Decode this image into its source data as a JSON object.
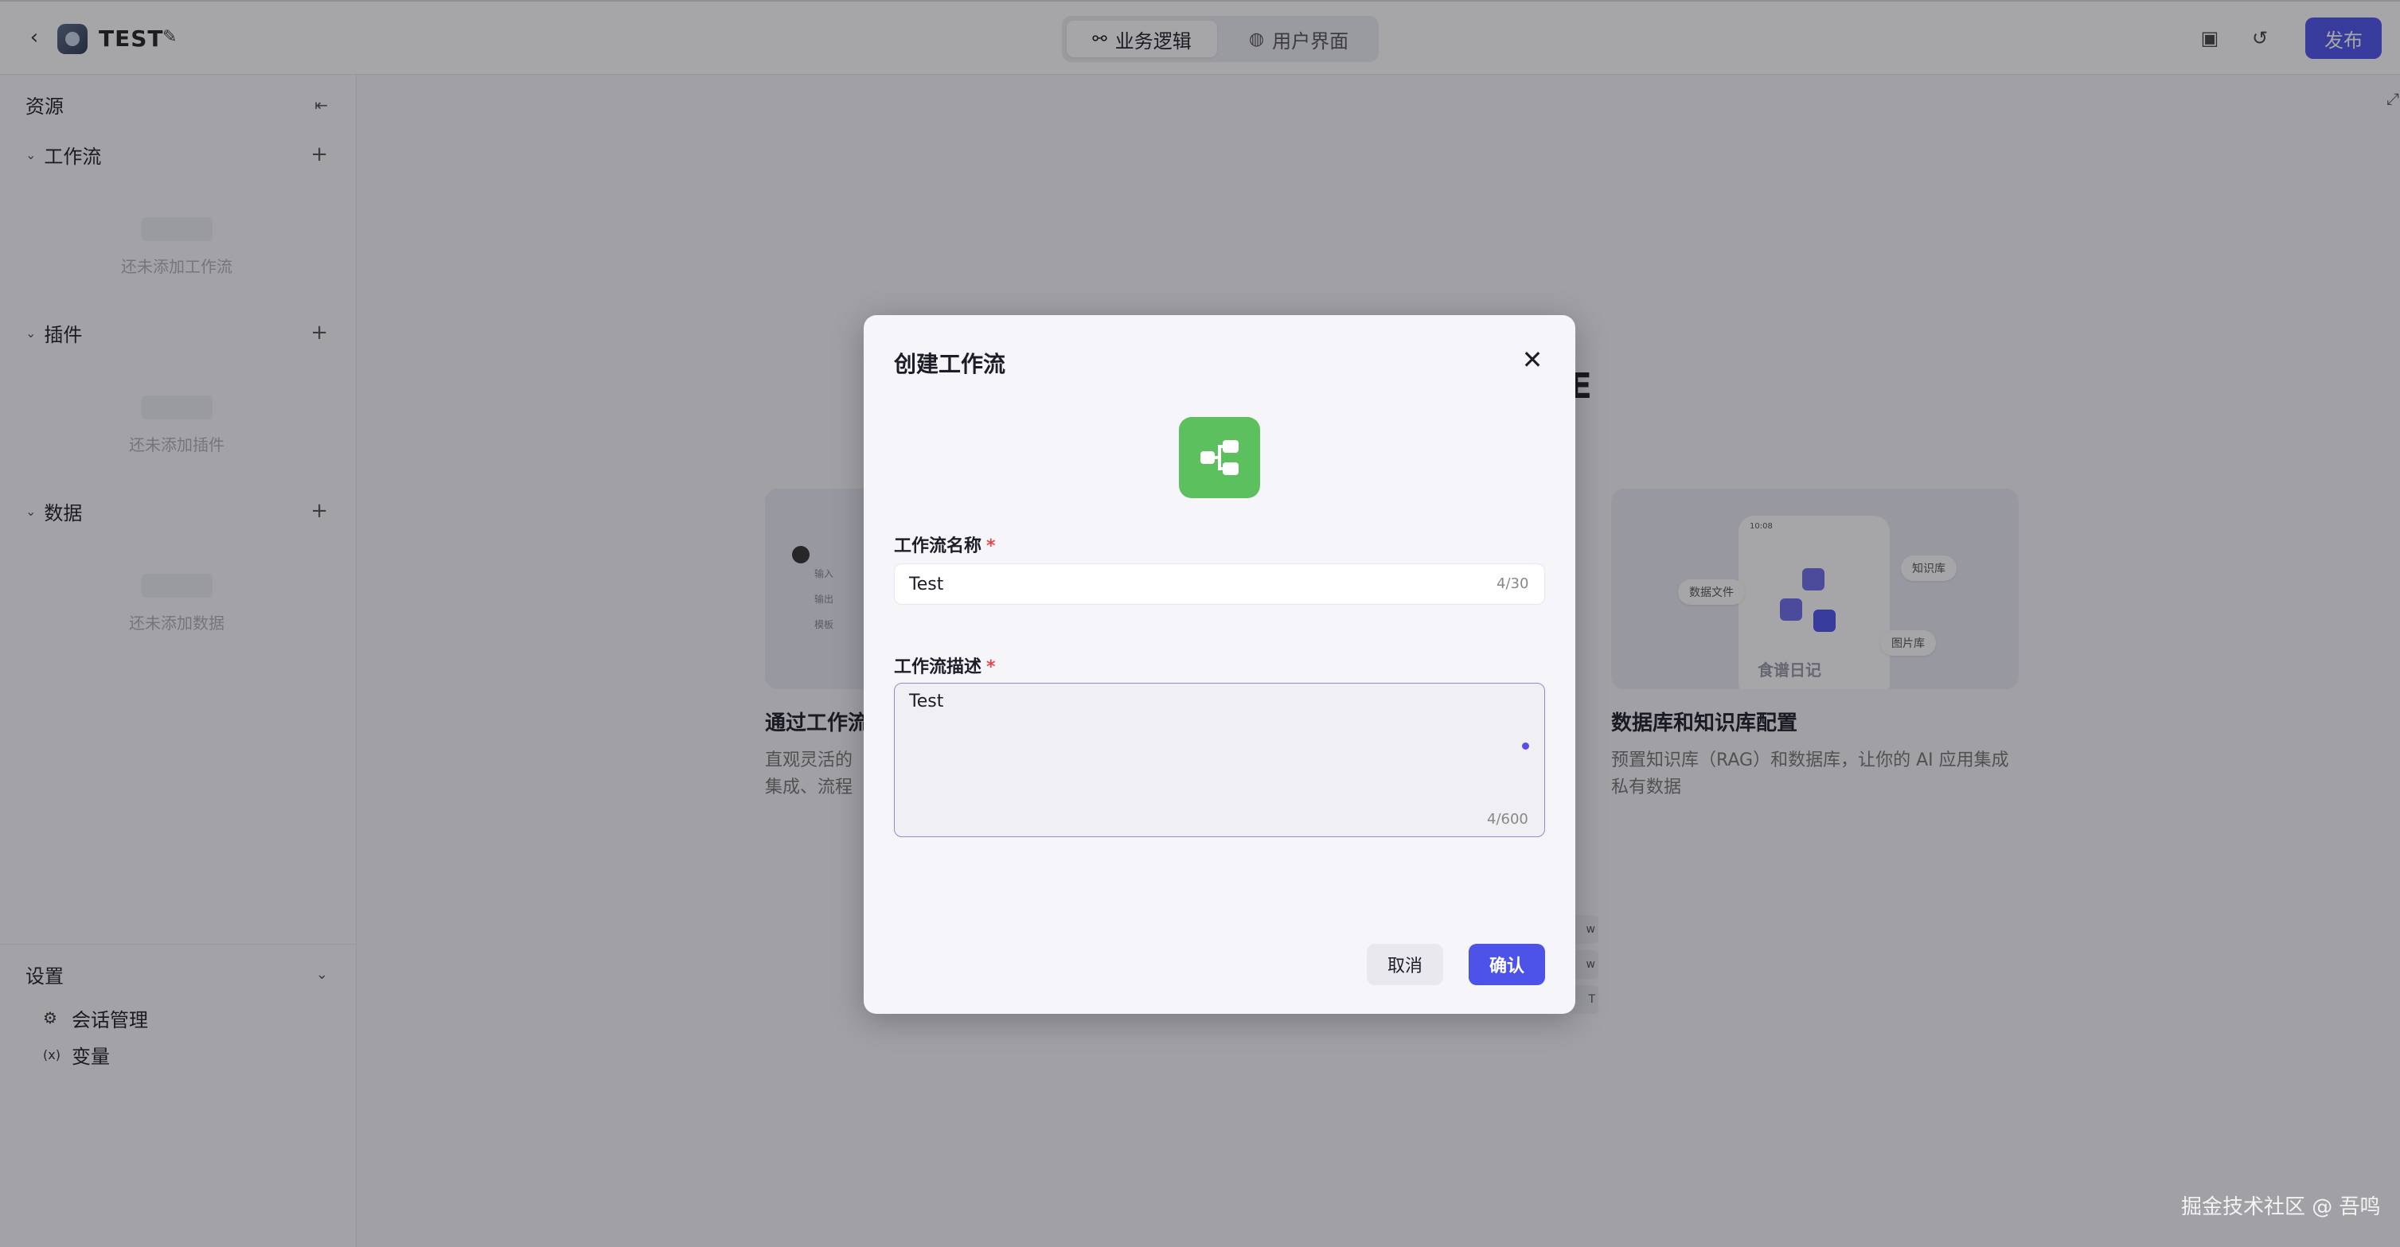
{
  "topbar": {
    "title": "TEST",
    "tabs": [
      {
        "label": "业务逻辑",
        "active": true
      },
      {
        "label": "用户界面",
        "active": false
      }
    ],
    "publish_label": "发布"
  },
  "sidebar": {
    "header": "资源",
    "sections": [
      {
        "label": "工作流",
        "empty_text": "还未添加工作流"
      },
      {
        "label": "插件",
        "empty_text": "还未添加插件"
      },
      {
        "label": "数据",
        "empty_text": "还未添加数据"
      }
    ],
    "settings": {
      "label": "设置",
      "items": [
        {
          "label": "会话管理",
          "icon": "chat-settings-icon"
        },
        {
          "label": "变量",
          "icon": "variable-icon"
        }
      ]
    }
  },
  "background": {
    "heading_fragment": "E",
    "cards": [
      {
        "title": "通过工作流",
        "desc_line1": "直观灵活的",
        "desc_line2": "集成、流程"
      },
      {
        "title": "数据库和知识库配置",
        "desc_line1": "预置知识库（RAG）和数据库，让你的 AI 应用集成",
        "desc_line2": "私有数据",
        "tags": [
          "数据文件",
          "知识库",
          "图片库"
        ],
        "phone_label": "食谱日记",
        "phone_time": "10:08"
      }
    ],
    "mini_tags": [
      "w",
      "w",
      "T"
    ],
    "card1_rows": [
      "输入",
      "输出",
      "模板"
    ]
  },
  "modal": {
    "title": "创建工作流",
    "name_label": "工作流名称",
    "name_value": "Test",
    "name_count": "4/30",
    "desc_label": "工作流描述",
    "desc_value": "Test",
    "desc_count": "4/600",
    "required_mark": "*",
    "cancel_label": "取消",
    "confirm_label": "确认"
  },
  "colors": {
    "accent": "#4d53e8",
    "icon_green": "#5dc05e",
    "required": "#e5484d"
  },
  "watermark": "掘金技术社区 @ 吾鸣"
}
